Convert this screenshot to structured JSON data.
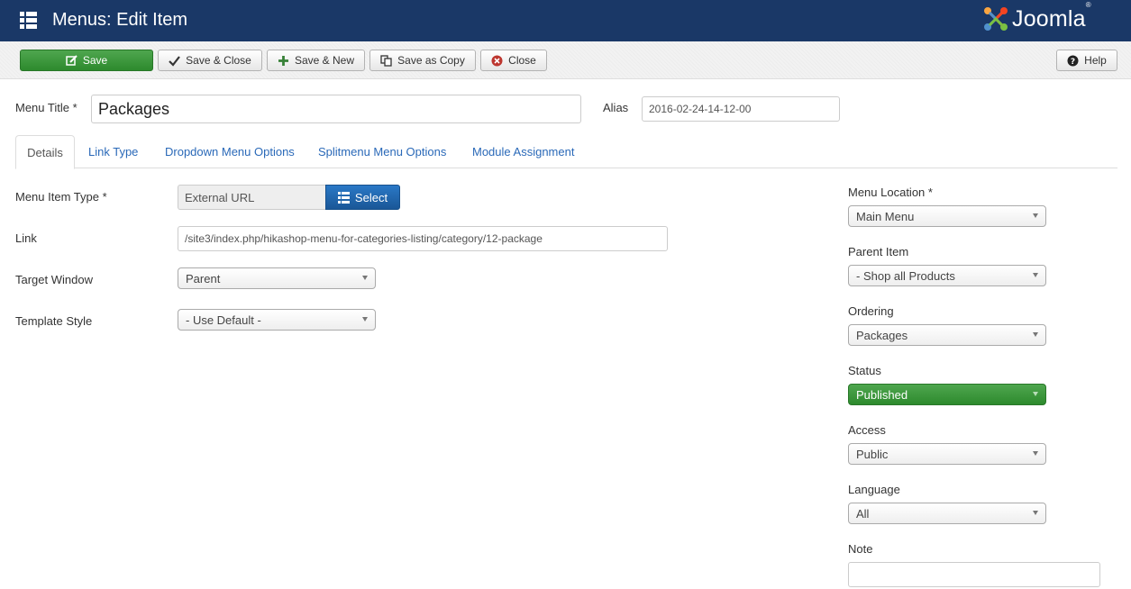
{
  "header": {
    "title": "Menus: Edit Item",
    "brand": "Joomla!",
    "color": "#1a3867"
  },
  "toolbar": {
    "save": "Save",
    "save_close": "Save & Close",
    "save_new": "Save & New",
    "save_copy": "Save as Copy",
    "close": "Close",
    "help": "Help"
  },
  "form": {
    "menu_title_label": "Menu Title *",
    "menu_title_value": "Packages",
    "alias_label": "Alias",
    "alias_value": "2016-02-24-14-12-00"
  },
  "tabs": [
    {
      "label": "Details",
      "active": true
    },
    {
      "label": "Link Type"
    },
    {
      "label": "Dropdown Menu Options"
    },
    {
      "label": "Splitmenu Menu Options"
    },
    {
      "label": "Module Assignment"
    }
  ],
  "details": {
    "item_type_label": "Menu Item Type *",
    "item_type_value": "External URL",
    "select_button": "Select",
    "link_label": "Link",
    "link_value": "/site3/index.php/hikashop-menu-for-categories-listing/category/12-package",
    "target_label": "Target Window",
    "target_value": "Parent",
    "template_label": "Template Style",
    "template_value": "- Use Default -"
  },
  "sidebar": {
    "location_label": "Menu Location *",
    "location_value": "Main Menu",
    "parent_label": "Parent Item",
    "parent_value": "- Shop all Products",
    "ordering_label": "Ordering",
    "ordering_value": "Packages",
    "status_label": "Status",
    "status_value": "Published",
    "access_label": "Access",
    "access_value": "Public",
    "language_label": "Language",
    "language_value": "All",
    "note_label": "Note",
    "note_value": ""
  }
}
